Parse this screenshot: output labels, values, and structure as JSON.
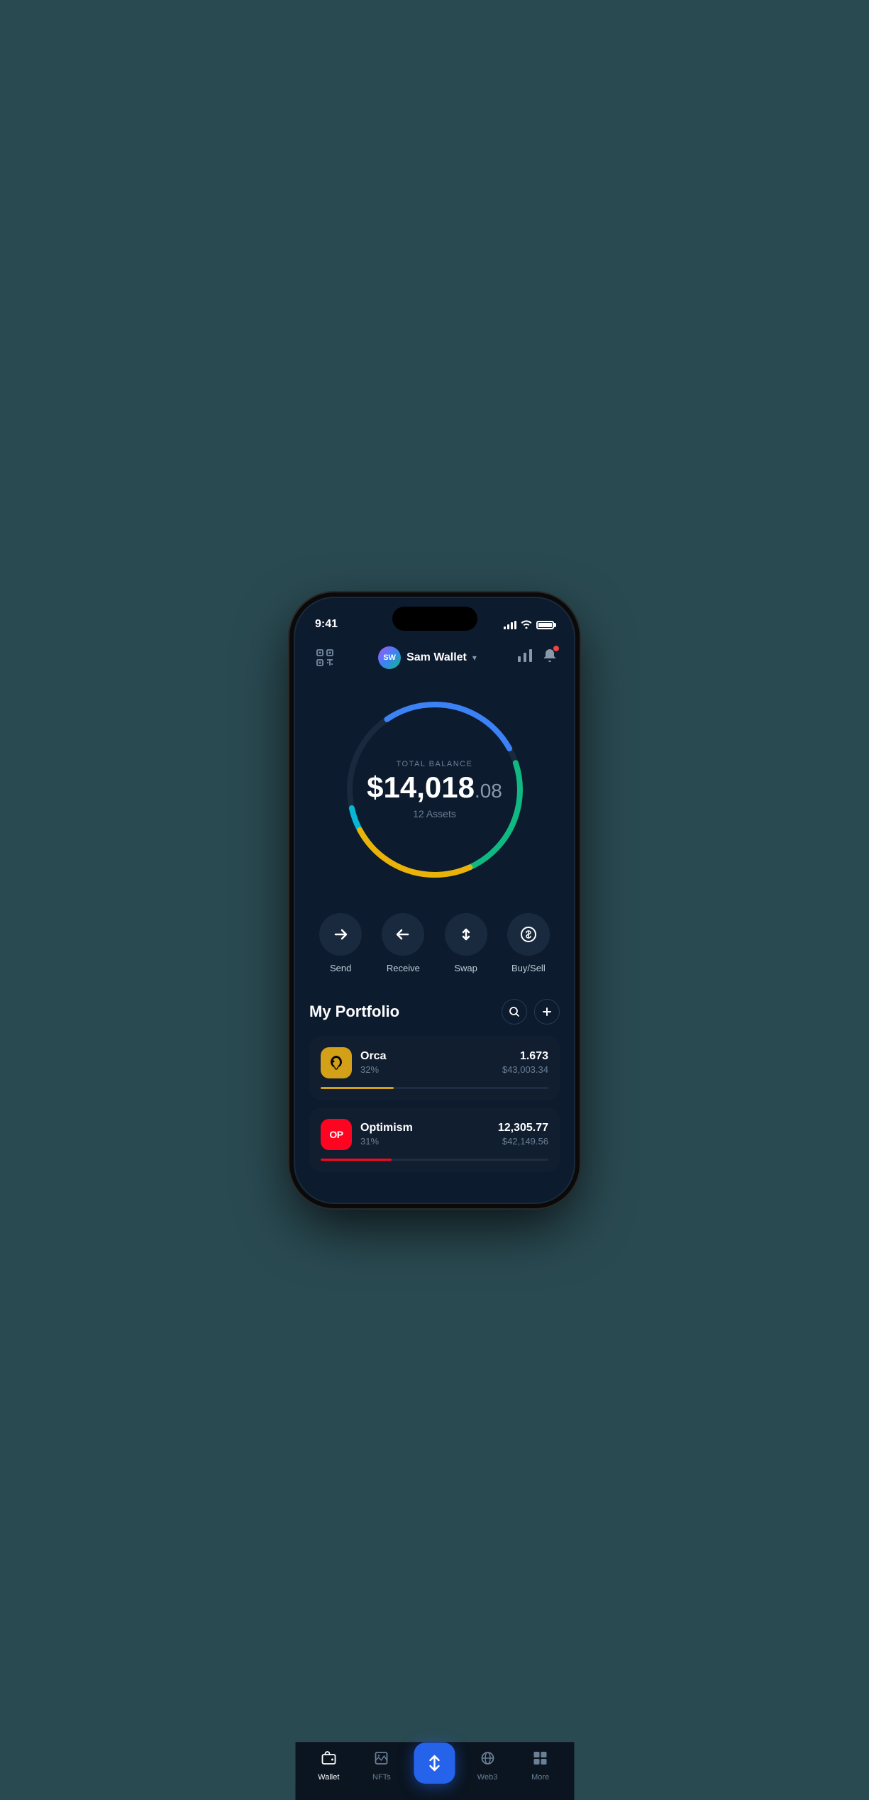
{
  "statusBar": {
    "time": "9:41",
    "batteryLevel": "100"
  },
  "header": {
    "scanIcon": "⊡",
    "avatarText": "SW",
    "walletName": "Sam Wallet",
    "chartIconLabel": "chart-icon",
    "bellIconLabel": "bell-icon"
  },
  "balance": {
    "label": "TOTAL BALANCE",
    "whole": "$14,018",
    "cents": ".08",
    "assetsCount": "12 Assets"
  },
  "actions": [
    {
      "id": "send",
      "label": "Send",
      "icon": "→"
    },
    {
      "id": "receive",
      "label": "Receive",
      "icon": "←"
    },
    {
      "id": "swap",
      "label": "Swap",
      "icon": "⇅"
    },
    {
      "id": "buysell",
      "label": "Buy/Sell",
      "icon": "ⓢ"
    }
  ],
  "portfolio": {
    "title": "My Portfolio",
    "searchLabel": "search",
    "addLabel": "add"
  },
  "assets": [
    {
      "id": "orca",
      "name": "Orca",
      "percentage": "32%",
      "amount": "1.673",
      "usdValue": "$43,003.34",
      "progressColor": "#d4a017",
      "progressWidth": 32,
      "iconBg": "#d4a017",
      "iconText": "🐋"
    },
    {
      "id": "optimism",
      "name": "Optimism",
      "percentage": "31%",
      "amount": "12,305.77",
      "usdValue": "$42,149.56",
      "progressColor": "#ff0420",
      "progressWidth": 31,
      "iconBg": "#ff0420",
      "iconText": "OP"
    }
  ],
  "bottomNav": [
    {
      "id": "wallet",
      "label": "Wallet",
      "icon": "👛",
      "active": true
    },
    {
      "id": "nfts",
      "label": "NFTs",
      "icon": "🖼",
      "active": false
    },
    {
      "id": "center",
      "label": "",
      "icon": "⇅",
      "active": false
    },
    {
      "id": "web3",
      "label": "Web3",
      "icon": "🌐",
      "active": false
    },
    {
      "id": "more",
      "label": "More",
      "icon": "⋮⋮",
      "active": false
    }
  ]
}
